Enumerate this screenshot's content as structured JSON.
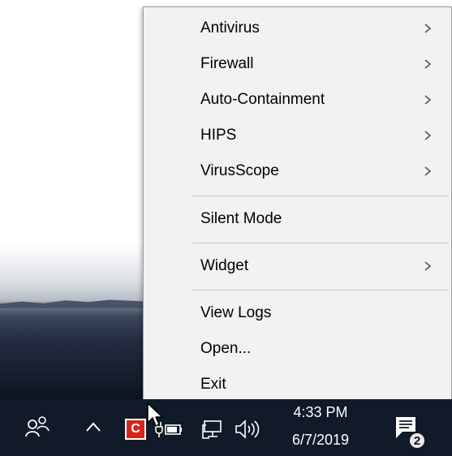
{
  "menu": {
    "items": [
      {
        "label": "Antivirus",
        "submenu": true
      },
      {
        "label": "Firewall",
        "submenu": true
      },
      {
        "label": "Auto-Containment",
        "submenu": true
      },
      {
        "label": "HIPS",
        "submenu": true
      },
      {
        "label": "VirusScope",
        "submenu": true
      },
      {
        "label": "Silent Mode",
        "submenu": false
      },
      {
        "label": "Widget",
        "submenu": true
      },
      {
        "label": "View Logs",
        "submenu": false
      },
      {
        "label": "Open...",
        "submenu": false
      },
      {
        "label": "Exit",
        "submenu": false
      }
    ],
    "chevron_glyph": ">"
  },
  "taskbar": {
    "app_icon_letter": "C",
    "clock_time": "4:33 PM",
    "clock_date": "6/7/2019",
    "notification_count": "2",
    "icons": [
      "people-icon",
      "show-hidden-icons-chevron",
      "comodo-tray-icon",
      "power-battery-icon",
      "network-icon",
      "volume-icon",
      "action-center-icon"
    ]
  },
  "colors": {
    "menu_background": "#f2f2f2",
    "taskbar_background": "#111a28",
    "app_icon_red": "#d9241c"
  }
}
